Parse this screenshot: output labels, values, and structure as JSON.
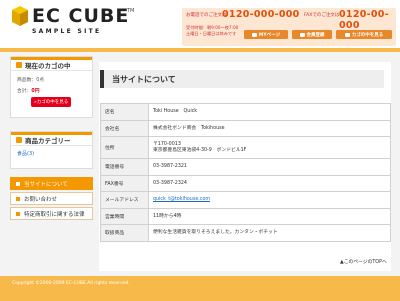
{
  "header": {
    "logo_main": "EC CUBE",
    "logo_tm": "TM",
    "logo_sub": "SAMPLE SITE",
    "order_phone_label": "お電話でのご注文は",
    "order_phone": "0120-000-000",
    "fax_label": "FAXでのご注文は",
    "fax_number": "0120-00-000",
    "hours_line1": "受付時間：朝9:00～夜7:00",
    "hours_line2": "土曜日・日曜日は休みです",
    "buttons": [
      {
        "label": "MYページ"
      },
      {
        "label": "会員登録"
      },
      {
        "label": "カゴの中を見る"
      }
    ]
  },
  "cart": {
    "title": "現在のカゴの中",
    "count_label": "商品数：0点",
    "total_label": "合計：",
    "total_value": "0円",
    "button": "»カゴの中を見る"
  },
  "category": {
    "title": "商品カテゴリー",
    "items": [
      {
        "label": "食品(3)"
      }
    ]
  },
  "side_menu": [
    {
      "label": "当サイトについて",
      "active": true
    },
    {
      "label": "お問い合わせ",
      "active": false
    },
    {
      "label": "特定商取引に関する法律",
      "active": false
    }
  ],
  "main": {
    "title": "当サイトについて",
    "rows": [
      {
        "label": "店名",
        "value": "Toki House　Quick"
      },
      {
        "label": "会社名",
        "value": "株式会社ボンド商会　Tokihouse"
      },
      {
        "label": "住所",
        "value": "〒170-0013",
        "value2": "東京都豊島区東池袋4-30-9　ボンドビル1F"
      },
      {
        "label": "電話番号",
        "value": "03-3987-2321"
      },
      {
        "label": "FAX番号",
        "value": "03-3987-2324"
      },
      {
        "label": "メールアドレス",
        "value": "quick_t@tokihouse.com",
        "link": true
      },
      {
        "label": "営業時間",
        "value": "11時から4時"
      },
      {
        "label": "取扱商品",
        "value": "便利な生活雑貨を取りそろえました。カンタン・ボチット"
      }
    ],
    "top_link": "▲このページのTOPへ"
  },
  "footer": {
    "copyright": "Copyright ©2000-2009 EC-CUBE All rights reserved."
  },
  "colors": {
    "accent": "#f39800",
    "footer": "#f7b94a",
    "red": "#e3001b"
  }
}
